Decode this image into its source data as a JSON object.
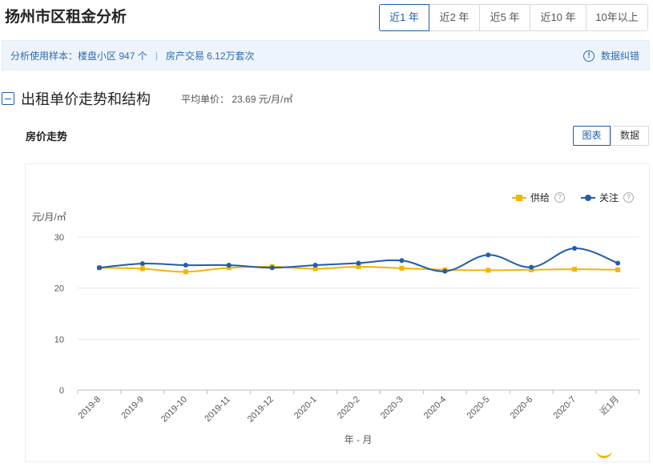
{
  "page": {
    "title": "扬州市区租金分析"
  },
  "range_tabs": [
    "近1 年",
    "近2 年",
    "近5 年",
    "近10 年",
    "10年以上"
  ],
  "info_bar": {
    "sample_prefix": "分析使用样本：",
    "sample_detail": "楼盘小区 947 个",
    "separator": "|",
    "trade": "房产交易 6.12万套次",
    "correction": "数据纠错",
    "info_icon_glyph": "!"
  },
  "section": {
    "title": "出租单价走势和结构",
    "avg_price": "平均单价： 23.69 元/月/㎡"
  },
  "sub_title": "房价走势",
  "view_toggle": {
    "chart": "图表",
    "data": "数据"
  },
  "legend": {
    "help_glyph": "?"
  },
  "colors": {
    "supply": "#f5b400",
    "attention": "#1f5ea8",
    "accent": "#1f5ea8",
    "grid": "#e6e6e6"
  },
  "icons": [
    "info-icon",
    "collapse-icon",
    "help-icon"
  ],
  "chart_data": {
    "type": "line",
    "categories": [
      "2019-8",
      "2019-9",
      "2019-10",
      "2019-11",
      "2019-12",
      "2020-1",
      "2020-2",
      "2020-3",
      "2020-4",
      "2020-5",
      "2020-6",
      "2020-7",
      "近1月"
    ],
    "series": [
      {
        "name": "供给",
        "values": [
          24.0,
          23.8,
          23.2,
          24.0,
          24.2,
          23.8,
          24.2,
          23.9,
          23.6,
          23.5,
          23.6,
          23.7,
          23.6
        ],
        "color": "#f5b400",
        "marker": "square"
      },
      {
        "name": "关注",
        "values": [
          24.0,
          24.8,
          24.5,
          24.5,
          24.0,
          24.5,
          24.9,
          25.4,
          23.3,
          26.5,
          24.1,
          27.8,
          24.9
        ],
        "color": "#1f5ea8",
        "marker": "circle"
      }
    ],
    "yticks": [
      0,
      10,
      20,
      30
    ],
    "ylim": [
      0,
      30
    ],
    "ylabel": "元/月/㎡",
    "xlabel": "年 - 月",
    "legend_position": "top-right",
    "grid": true
  }
}
